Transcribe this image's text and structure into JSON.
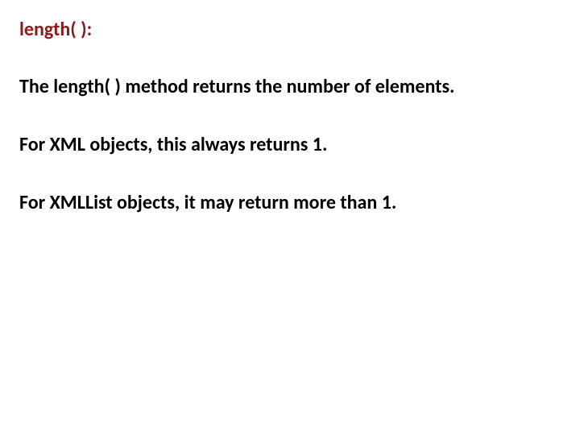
{
  "heading": "length( ):",
  "paragraphs": {
    "p1": "The length( ) method returns the number of elements.",
    "p2": "For XML objects, this always returns 1.",
    "p3": "For XMLList objects, it may return more than 1."
  }
}
